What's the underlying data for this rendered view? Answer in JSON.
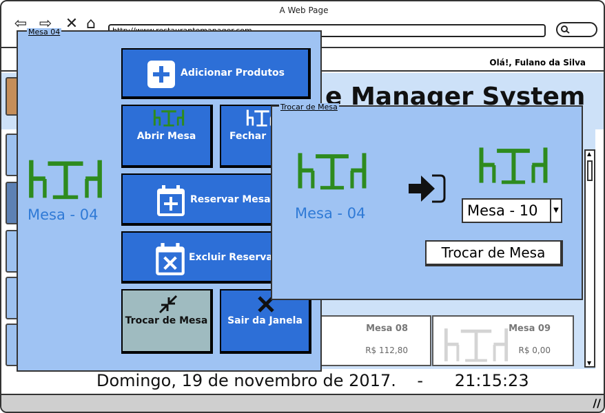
{
  "browser": {
    "window_title": "A Web Page",
    "url": "http://www.restaurantemanager.com"
  },
  "app": {
    "greeting": "Olá!, Fulano da Silva",
    "title": "e Manager System",
    "datetime": "Domingo, 19 de novembro de 2017.    -      21:15:23",
    "tables": [
      {
        "name": "Mesa 08",
        "price": "R$ 112,80"
      },
      {
        "name": "Mesa 09",
        "price": "R$ 0,00"
      }
    ]
  },
  "mesa_dialog": {
    "title": "Mesa 04",
    "table_label": "Mesa - 04",
    "actions": {
      "add_products": "Adicionar Produtos",
      "open_table": "Abrir Mesa",
      "close_table": "Fechar",
      "reserve_table": "Reservar Mesa",
      "delete_reservation": "Excluir Reserva",
      "change_table": "Trocar de Mesa",
      "exit_window": "Sair da Janela"
    }
  },
  "trocar_dialog": {
    "title": "Trocar de Mesa",
    "source_label": "Mesa - 04",
    "target_selected": "Mesa - 10",
    "confirm_label": "Trocar de Mesa"
  },
  "colors": {
    "dialog_bg": "#9fc3f3",
    "tile_blue": "#2d6fd7",
    "table_green": "#2e8b1e",
    "label_blue": "#2f7ad6"
  }
}
